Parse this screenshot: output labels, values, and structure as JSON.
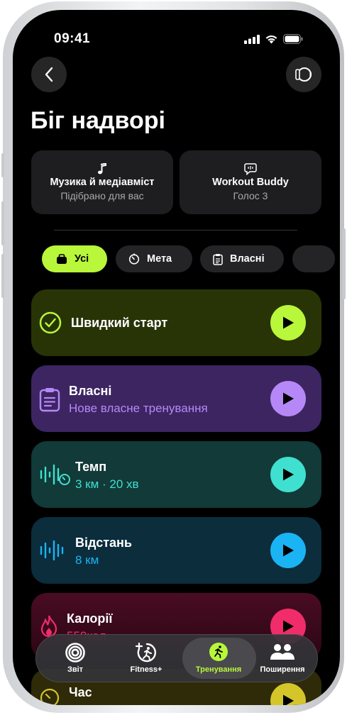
{
  "status": {
    "time": "09:41"
  },
  "header": {
    "title": "Біг надворі"
  },
  "cards": [
    {
      "title": "Музика й медіавміст",
      "subtitle": "Підібрано для вас",
      "icon": "music-note-icon"
    },
    {
      "title": "Workout Buddy",
      "subtitle": "Голос 3",
      "icon": "speech-bubble-icon"
    }
  ],
  "filters": [
    {
      "label": "Усі",
      "icon": "bag-icon",
      "active": true
    },
    {
      "label": "Мета",
      "icon": "timer-icon",
      "active": false
    },
    {
      "label": "Власні",
      "icon": "clipboard-icon",
      "active": false
    }
  ],
  "workouts": [
    {
      "name": "Швидкий старт",
      "subtitle": "",
      "accent": "#b8f73a"
    },
    {
      "name": "Власні",
      "subtitle": "Нове власне тренування",
      "accent": "#b688f7"
    },
    {
      "name": "Темп",
      "subtitle": "3 км · 20 хв",
      "accent": "#3fe0d0"
    },
    {
      "name": "Відстань",
      "subtitle": "8 км",
      "accent": "#1ab4f5"
    },
    {
      "name": "Калорії",
      "subtitle": "550кал",
      "accent": "#f02c6b"
    },
    {
      "name": "Час",
      "subtitle": "",
      "accent": "#d4c52a"
    }
  ],
  "tabbar": [
    {
      "label": "Звіт",
      "icon": "rings-icon"
    },
    {
      "label": "Fitness+",
      "icon": "fitness-plus-icon"
    },
    {
      "label": "Тренування",
      "icon": "runner-icon",
      "active": true
    },
    {
      "label": "Поширення",
      "icon": "people-icon"
    }
  ]
}
